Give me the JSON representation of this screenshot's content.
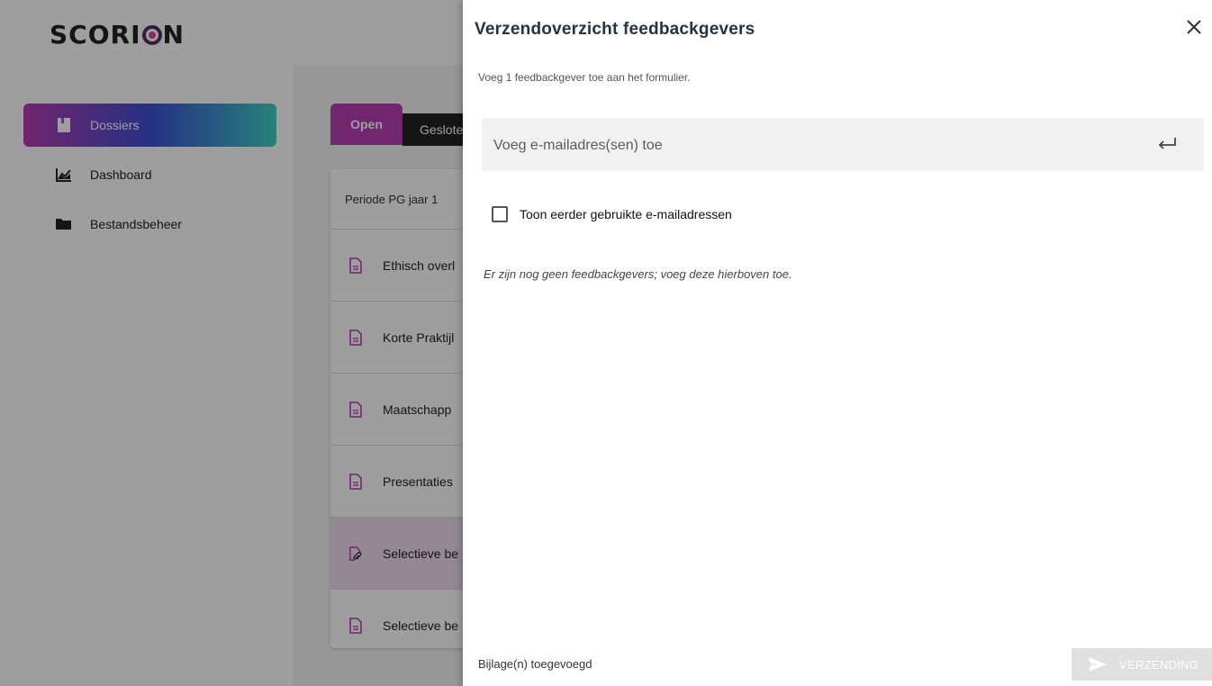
{
  "brand": {
    "logo_text_a": "SCORI",
    "logo_text_b": "N"
  },
  "sidebar": {
    "items": [
      {
        "label": "Dossiers",
        "icon": "file-icon",
        "active": true
      },
      {
        "label": "Dashboard",
        "icon": "chart-icon",
        "active": false
      },
      {
        "label": "Bestandsbeheer",
        "icon": "folder-icon",
        "active": false
      }
    ]
  },
  "tabs": {
    "open": "Open",
    "closed": "Geslote"
  },
  "list": {
    "header": "Periode PG jaar 1",
    "rows": [
      {
        "label": "Ethisch overl",
        "icon": "document-icon"
      },
      {
        "label": "Korte Praktijl",
        "icon": "document-icon"
      },
      {
        "label": "Maatschapp",
        "icon": "document-icon"
      },
      {
        "label": "Presentaties",
        "icon": "document-icon"
      },
      {
        "label": "Selectieve be",
        "icon": "document-attachment-icon",
        "selected": true
      },
      {
        "label": "Selectieve be",
        "icon": "document-icon"
      }
    ]
  },
  "dialog": {
    "title": "Verzendoverzicht feedbackgevers",
    "info": "Voeg 1 feedbackgever toe aan het formulier.",
    "email_placeholder": "Voeg e-mailadres(sen) toe",
    "email_value": "",
    "checkbox_label": "Toon eerder gebruikte e-mailadressen",
    "checkbox_checked": false,
    "empty_message": "Er zijn nog geen feedbackgevers; voeg deze hierboven toe.",
    "attachments_label": "Bijlage(n) toegevoegd",
    "send_label": "VERZENDING"
  },
  "colors": {
    "accent_purple": "#b53fb5",
    "gradient": [
      "#b83cb0",
      "#3d4fd6",
      "#3fd1c6"
    ],
    "title_color": "#263340",
    "disabled_button": "#e0e0e0"
  }
}
